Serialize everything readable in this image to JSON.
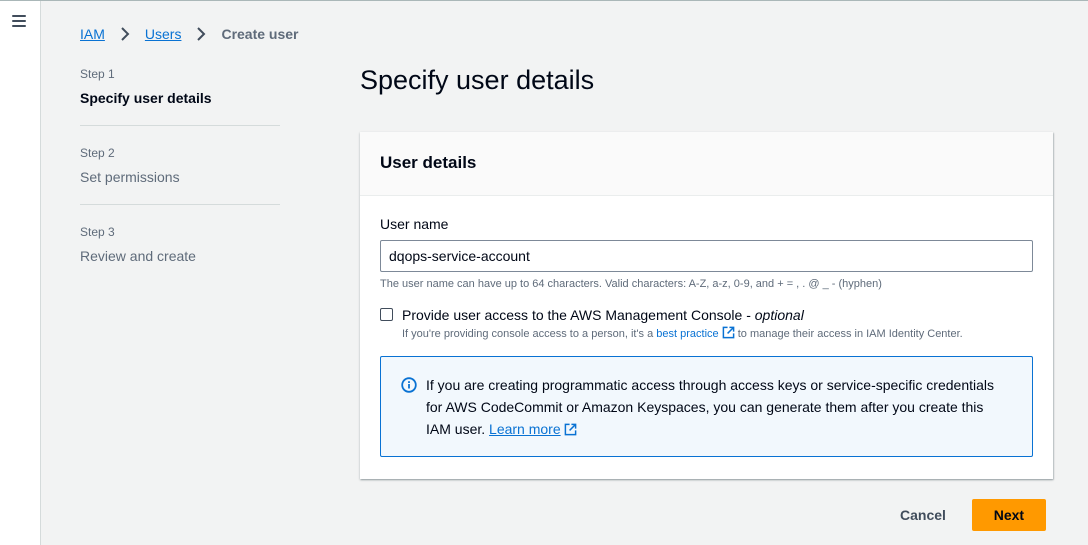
{
  "breadcrumb": {
    "items": [
      "IAM",
      "Users"
    ],
    "current": "Create user"
  },
  "steps": [
    {
      "number": "Step 1",
      "title": "Specify user details"
    },
    {
      "number": "Step 2",
      "title": "Set permissions"
    },
    {
      "number": "Step 3",
      "title": "Review and create"
    }
  ],
  "page_title": "Specify user details",
  "container": {
    "header": "User details",
    "username": {
      "label": "User name",
      "value": "dqops-service-account",
      "constraint": "The user name can have up to 64 characters. Valid characters: A-Z, a-z, 0-9, and + = , . @ _ - (hyphen)"
    },
    "console_access": {
      "label": "Provide user access to the AWS Management Console - ",
      "optional": "optional",
      "desc_prefix": "If you're providing console access to a person, it's a ",
      "desc_link": "best practice",
      "desc_suffix": " to manage their access in IAM Identity Center.",
      "checked": false
    },
    "alert": {
      "text": "If you are creating programmatic access through access keys or service-specific credentials for AWS CodeCommit or Amazon Keyspaces, you can generate them after you create this IAM user. ",
      "link": "Learn more"
    }
  },
  "actions": {
    "cancel": "Cancel",
    "next": "Next"
  },
  "icons": {
    "menu": "hamburger-menu-icon",
    "separator": "chevron-right-icon",
    "external": "external-link-icon",
    "info": "info-circle-icon"
  },
  "colors": {
    "link": "#0972d3",
    "primary_button": "#ff9900",
    "alert_border": "#0972d3",
    "alert_bg": "#f2f8fd"
  }
}
